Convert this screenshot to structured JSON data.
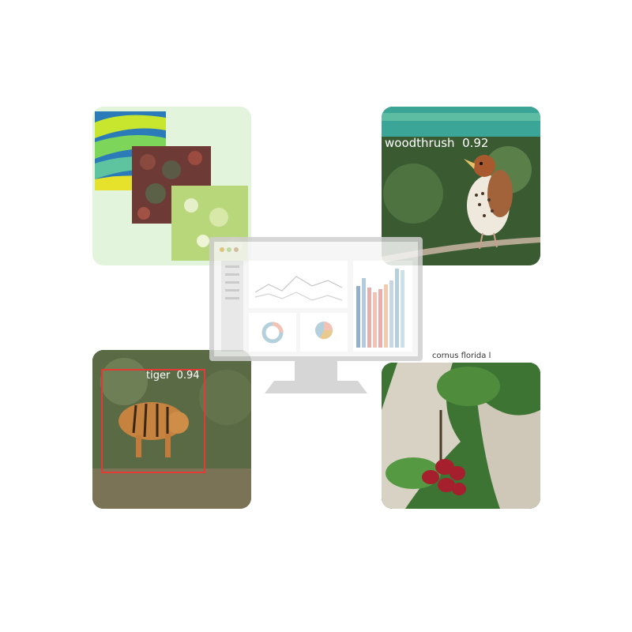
{
  "cards": {
    "satellite": {},
    "bird": {
      "detection_label": "woodthrush  0.92"
    },
    "tiger": {
      "detection_label": "tiger  0.94"
    },
    "plant": {
      "caption": "cornus florida l"
    }
  },
  "colors": {
    "satellite_bg": "#e3f4dc",
    "bird_bg": "#2f4a2c",
    "tiger_bg": "#4f5d3d",
    "plant_bg": "#3f7a36",
    "detection_box": "#e53935",
    "monitor": "#c9c9c9",
    "bar_colors": [
      "#7fa3c4",
      "#e3a0a0",
      "#f0b9a8",
      "#a8c8d8"
    ]
  },
  "icons": [
    "monitor-icon",
    "line-chart-icon",
    "bar-chart-icon",
    "donut-chart-icon",
    "pie-chart-icon"
  ]
}
